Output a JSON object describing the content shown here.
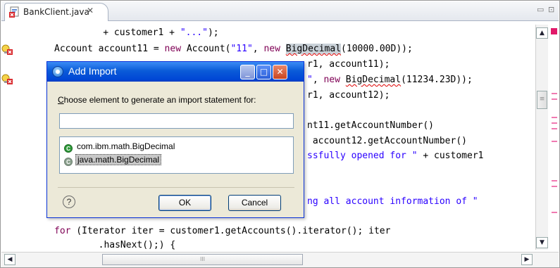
{
  "editor": {
    "tab_title": "BankClient.java",
    "tab_close_glyph": "✕",
    "minimize_glyph": "▭",
    "maximize_glyph": "⊡",
    "colors": {
      "keyword": "#7f0055",
      "string": "#2a00ff",
      "error_squiggle": "#e00000",
      "occurrence_highlight": "#c9d1d8"
    },
    "lines": {
      "l1_code": "                + customer1 + ",
      "l1_str": "\"...\"",
      "l1_end": ");",
      "l2_a": "Account account11 = ",
      "l2_kw": "new",
      "l2_b": " Account(",
      "l2_str": "\"11\"",
      "l2_c": ", ",
      "l2_kw2": "new",
      "l2_d": " ",
      "l2_big": "BigDecimal",
      "l2_e": "(10000.00D));",
      "l3": "r1, account11);",
      "l4_str": "\"",
      "l4_a": ", ",
      "l4_kw": "new",
      "l4_b": " ",
      "l4_big": "BigDecimal",
      "l4_c": "(11234.23D));",
      "l5": "r1, account12);",
      "l6": "nt11.getAccountNumber()",
      "l7": " account12.getAccountNumber()",
      "l8_str": "ssfully opened for \"",
      "l8_rest": " + customer1",
      "l9_str": "ng all account information of \"",
      "l10_a": "for",
      "l10_b": " (Iterator iter = customer1.getAccounts().iterator(); iter",
      "l11": "        .hasNext();) {"
    },
    "scroll": {
      "up_glyph": "▲",
      "down_glyph": "▼",
      "left_glyph": "◀",
      "right_glyph": "▶",
      "thumb_grip": "≡",
      "hthumb_grip": "III"
    }
  },
  "dialog": {
    "title": "Add Import",
    "min_glyph": "_",
    "max_glyph": "□",
    "close_glyph": "✕",
    "prompt_first": "C",
    "prompt_rest": "hoose element to generate an import statement for:",
    "filter_value": "",
    "items": [
      {
        "label": "com.ibm.math.BigDecimal",
        "icon": "class-icon"
      },
      {
        "label": "java.math.BigDecimal",
        "icon": "class-icon"
      }
    ],
    "class_icon_glyph": "C",
    "help_glyph": "?",
    "ok_label": "OK",
    "cancel_label": "Cancel"
  }
}
